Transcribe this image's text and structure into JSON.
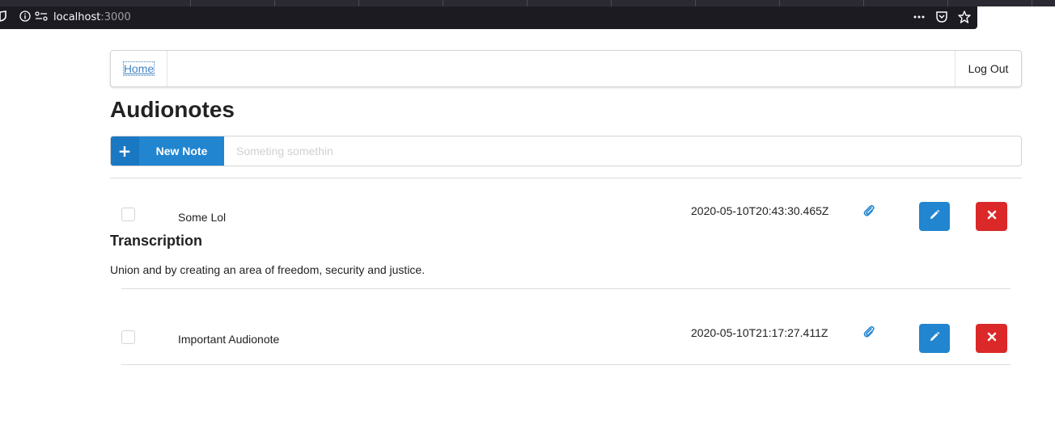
{
  "browser": {
    "url_host": "localhost",
    "url_port": ":3000"
  },
  "nav": {
    "home_label": "Home",
    "logout_label": "Log Out"
  },
  "page": {
    "title": "Audionotes"
  },
  "new_note": {
    "button_label": "New Note",
    "button_icon": "plus-icon",
    "input_placeholder": "Someting somethin",
    "input_value": ""
  },
  "notes": [
    {
      "title": "Some Lol",
      "date": "2020-05-10T20:43:30.465Z",
      "checked": false,
      "transcription_heading": "Transcription",
      "transcription": "Union and by creating an area of freedom, security and justice."
    },
    {
      "title": "Important Audionote",
      "date": "2020-05-10T21:17:27.411Z",
      "checked": false
    }
  ],
  "colors": {
    "primary": "#2185d0",
    "danger": "#db2828",
    "link": "#4183c4"
  }
}
